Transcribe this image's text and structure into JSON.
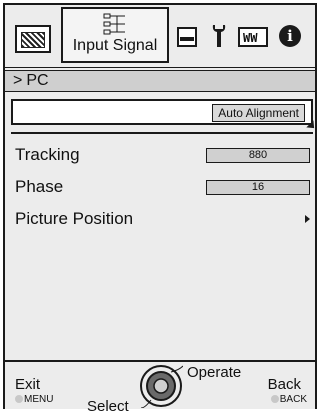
{
  "tabs": [
    {
      "icon": "test-pattern-icon",
      "active": false
    },
    {
      "icon": "input-signal-icon",
      "label": "Input Signal",
      "active": true
    },
    {
      "icon": "picture-icon",
      "active": false
    },
    {
      "icon": "wrench-icon",
      "active": false
    },
    {
      "icon": "keys-icon",
      "label": "WW",
      "active": false
    },
    {
      "icon": "info-icon",
      "label": "i",
      "active": false
    }
  ],
  "breadcrumb": {
    "arrow": ">",
    "text": "PC"
  },
  "auto_alignment": {
    "label": "Auto Alignment"
  },
  "menu": {
    "tracking": {
      "label": "Tracking",
      "value": "880"
    },
    "phase": {
      "label": "Phase",
      "value": "16"
    },
    "picture_position": {
      "label": "Picture Position"
    }
  },
  "footer": {
    "exit_label": "Exit",
    "exit_key": "MENU",
    "select_label": "Select",
    "operate_label": "Operate",
    "back_label": "Back",
    "back_key": "BACK"
  },
  "colors": {
    "background": "#ececec",
    "border": "#1a1a1a",
    "breadcrumb_bg": "#cfcfcf",
    "slider_bg": "#d0d0d0"
  }
}
